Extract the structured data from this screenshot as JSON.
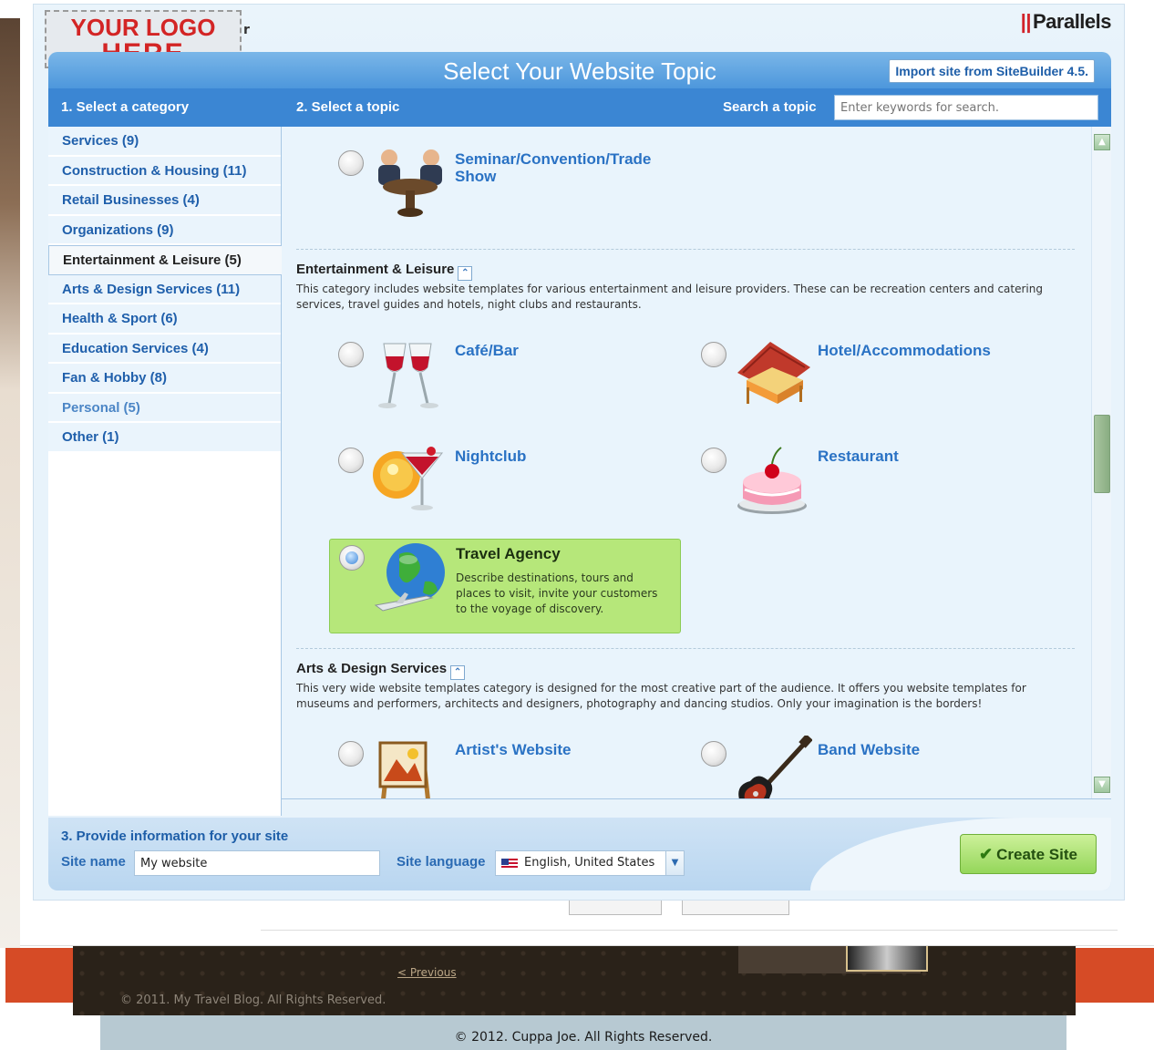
{
  "background": {
    "prev_link": "< Previous",
    "copyright_1": "© 2011. My Travel Blog. All Rights Reserved.",
    "copyright_2": "© 2012. Cuppa Joe. All Rights Reserved."
  },
  "header": {
    "logo_line1": "YOUR LOGO",
    "logo_line2": "HERE",
    "logo_overflow": "r",
    "brand_bars": "||",
    "brand_name": "Parallels",
    "title": "Select Your Website Topic",
    "import_button": "Import site from SiteBuilder 4.5."
  },
  "columns": {
    "category_header": "1. Select a category",
    "topic_header": "2. Select a topic",
    "search_label": "Search a topic",
    "search_placeholder": "Enter keywords for search."
  },
  "categories": [
    {
      "label": "Services (9)"
    },
    {
      "label": "Construction & Housing (11)"
    },
    {
      "label": "Retail Businesses (4)"
    },
    {
      "label": "Organizations (9)"
    },
    {
      "label": "Entertainment & Leisure (5)",
      "selected": true
    },
    {
      "label": "Arts & Design Services (11)"
    },
    {
      "label": "Health & Sport (6)"
    },
    {
      "label": "Education Services (4)"
    },
    {
      "label": "Fan & Hobby (8)"
    },
    {
      "label": "Personal (5)"
    },
    {
      "label": "Other (1)"
    }
  ],
  "topics": {
    "seminar": {
      "name": "Seminar/Convention/Trade Show",
      "icon": "seminar-people-icon"
    },
    "entertainment": {
      "heading": "Entertainment & Leisure",
      "collapse_icon": "double-chevron-up-icon",
      "description": "This category includes website templates for various entertainment and leisure providers. These can be recreation centers and catering services, travel guides and hotels, night clubs and restaurants.",
      "cafe": {
        "name": "Café/Bar",
        "icon": "wine-glasses-icon"
      },
      "hotel": {
        "name": "Hotel/Accommodations",
        "icon": "bed-house-icon"
      },
      "nightclub": {
        "name": "Nightclub",
        "icon": "cocktail-disco-icon"
      },
      "restaurant": {
        "name": "Restaurant",
        "icon": "cake-icon"
      },
      "travel": {
        "name": "Travel Agency",
        "icon": "globe-plane-icon",
        "description": "Describe destinations, tours and places to visit, invite your customers to the voyage of discovery.",
        "selected": true
      }
    },
    "arts": {
      "heading": "Arts & Design Services",
      "collapse_icon": "double-chevron-up-icon",
      "description": "This very wide website templates category is designed for the most creative part of the audience. It offers you website templates for museums and performers, architects and designers, photography and dancing studios. Only your imagination is the borders!",
      "artist": {
        "name": "Artist's Website",
        "icon": "easel-painting-icon"
      },
      "band": {
        "name": "Band Website",
        "icon": "electric-guitar-icon"
      }
    }
  },
  "site_info": {
    "heading": "3. Provide information for your site",
    "name_label": "Site name",
    "name_value": "My website",
    "language_label": "Site language",
    "language_value": "English, United States",
    "create_button": "Create Site"
  },
  "colors": {
    "accent_blue": "#3b86d3",
    "selected_green": "#b6e77a",
    "brand_red": "#d2232a",
    "logo_red": "#d32525"
  }
}
